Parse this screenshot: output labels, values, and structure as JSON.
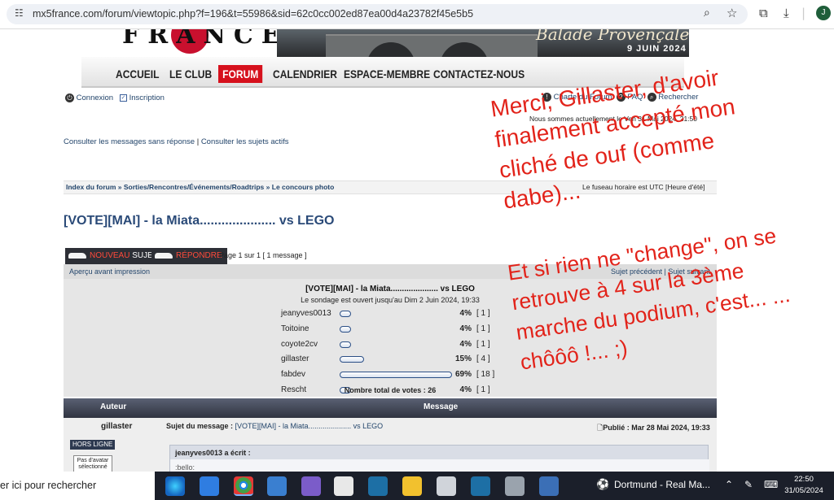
{
  "browser": {
    "url": "mx5france.com/forum/viewtopic.php?f=196&t=55986&sid=62c0cc002ed87ea00d4a23782f45e5b5",
    "profile_initial": "J"
  },
  "banner": {
    "logo_text": "FRANCE",
    "event_title": "Balade Provençale",
    "event_date": "9 JUIN 2024"
  },
  "nav": {
    "items": [
      "ACCUEIL",
      "LE CLUB",
      "FORUM",
      "CALENDRIER",
      "ESPACE-MEMBRE",
      "CONTACTEZ-NOUS"
    ],
    "active": "FORUM"
  },
  "userbar": {
    "login": "Connexion",
    "register": "Inscription",
    "charte": "Charte du Forum",
    "faq": "FAQ",
    "search": "Rechercher",
    "now": "Nous sommes actuellement le Ven 31 Mai 2024, 21:50"
  },
  "links": {
    "unanswered": "Consulter les messages sans réponse",
    "separator": "|",
    "active_topics": "Consulter les sujets actifs"
  },
  "breadcrumb": {
    "path": [
      "Index du forum",
      "Sorties/Rencontres/Événements/Roadtrips",
      "Le concours photo"
    ],
    "sep": "»",
    "timezone": "Le fuseau horaire est UTC [Heure d'été]"
  },
  "topic": {
    "title": "[VOTE][MAI] - la Miata..................... vs LEGO",
    "btn_new_a": "Nouveau",
    "btn_new_b": "Sujet",
    "btn_reply": "Répondre",
    "pagination": "Page 1 sur 1   [ 1 message ]",
    "print": "Aperçu avant impression",
    "prev_next": "Sujet précédent | Sujet suivant"
  },
  "poll": {
    "title": "[VOTE][MAI] - la Miata..................... vs LEGO",
    "subtitle": "Le sondage est ouvert jusqu'au Dim 2 Juin 2024, 19:33",
    "options": [
      {
        "name": "jeanyves0013",
        "pct": "4%",
        "count": "[ 1 ]",
        "fraction": 0.04
      },
      {
        "name": "Toitoine",
        "pct": "4%",
        "count": "[ 1 ]",
        "fraction": 0.04
      },
      {
        "name": "coyote2cv",
        "pct": "4%",
        "count": "[ 1 ]",
        "fraction": 0.04
      },
      {
        "name": "gillaster",
        "pct": "15%",
        "count": "[ 4 ]",
        "fraction": 0.15
      },
      {
        "name": "fabdev",
        "pct": "69%",
        "count": "[ 18 ]",
        "fraction": 0.69
      },
      {
        "name": "Rescht",
        "pct": "4%",
        "count": "[ 1 ]",
        "fraction": 0.04
      }
    ],
    "total": "Nombre total de votes : 26"
  },
  "table": {
    "col_author": "Auteur",
    "col_message": "Message"
  },
  "post": {
    "author": "gillaster",
    "status": "HORS LIGNE",
    "avatar_text": "Pas d'avatar sélectionné",
    "subject_label": "Sujet du message :",
    "subject": "[VOTE][MAI] - la Miata..................... vs LEGO",
    "published": "Publié : Mar 28 Mai 2024, 19:33",
    "quote_author": "jeanyves0013 a écrit :",
    "quote_text": ":bello:"
  },
  "annotation": {
    "lines_1": [
      "Merci, Gillaster, d'avoir",
      "finalement accepté mon",
      "cliché de ouf (comme",
      "dabe)..."
    ],
    "lines_2": [
      "Et si rien ne \"change\", on se",
      "retrouve à 4 sur la 3ème",
      "marche du podium, c'est... ...",
      "chôôô !...    ;)"
    ],
    "color": "#e2231a"
  },
  "taskbar": {
    "search": "er ici pour rechercher",
    "weather": "Dortmund - Real Ma...",
    "time": "22:50",
    "date": "31/05/2024"
  }
}
